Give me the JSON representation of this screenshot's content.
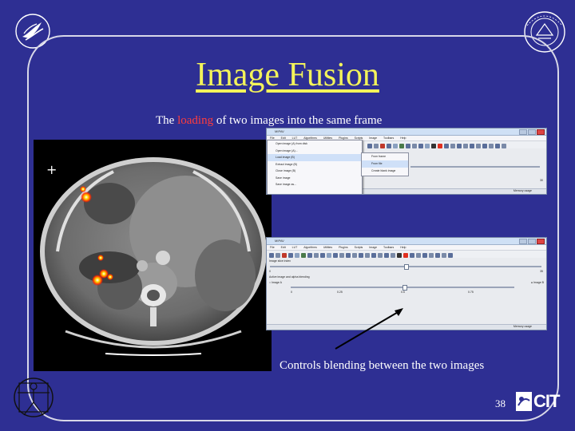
{
  "slide": {
    "title": "Image Fusion",
    "subtitle_pre": "The ",
    "subtitle_highlight": "loading",
    "subtitle_post": " of two images into the same frame",
    "caption": "Controls blending between the two images",
    "page_number": "38",
    "footer_logo": "CIT",
    "colors": {
      "background": "#2e2f93",
      "title": "#f3f35a",
      "highlight": "#ff3c3c",
      "text": "#ffffff"
    }
  },
  "window_top": {
    "menu": [
      "File",
      "Edit",
      "LUT",
      "Algorithms",
      "Utilities",
      "Plugins",
      "Scripts",
      "Image",
      "Toolbars",
      "Help"
    ],
    "file_menu_items": [
      "Open image (A) from disk",
      "Open image (A)...",
      "Load image (B)",
      "Extract image (B)",
      "Close image (B)",
      "Save image",
      "Save image as..."
    ],
    "submenu_items": [
      "From frame",
      "From file",
      "Create blank image"
    ],
    "slider_max": "30",
    "memory_label": "Memory usage"
  },
  "window_bottom": {
    "menu": [
      "File",
      "Edit",
      "LUT",
      "Algorithms",
      "Utilities",
      "Plugins",
      "Scripts",
      "Image",
      "Toolbars",
      "Help"
    ],
    "slice_label": "Image slice index",
    "slider_min": "0",
    "slider_max": "35",
    "blend_label": "Active image and alpha blending",
    "image_a": "Image A",
    "image_b": "Image B",
    "tick_left": "0",
    "tick_mid": "0.25",
    "tick_center": "0.5",
    "tick_right": "0.75",
    "memory_label": "Memory usage"
  }
}
